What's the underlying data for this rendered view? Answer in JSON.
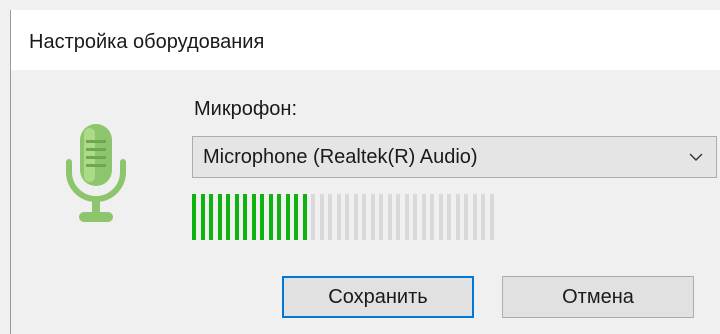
{
  "window": {
    "title": "Настройка оборудования"
  },
  "microphone": {
    "label": "Микрофон:",
    "selected_device": "Microphone (Realtek(R) Audio)",
    "level": {
      "active_segments": 14,
      "total_segments": 36
    }
  },
  "buttons": {
    "save_label": "Сохранить",
    "cancel_label": "Отмена"
  },
  "colors": {
    "level_active": "#0fb20f",
    "level_inactive": "#d9d9d9",
    "primary_border": "#0078d7",
    "mic_icon": "#8cc56b"
  },
  "icons": {
    "microphone": "microphone-icon",
    "dropdown": "chevron-down-icon"
  }
}
